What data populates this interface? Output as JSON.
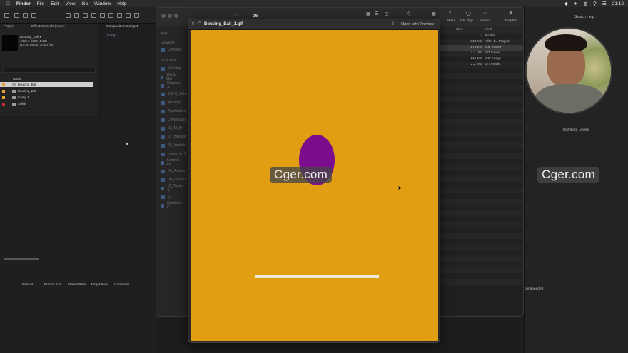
{
  "menubar": {
    "app": "Finder",
    "items": [
      "File",
      "Edit",
      "View",
      "Go",
      "Window",
      "Help"
    ],
    "time": "21:12"
  },
  "project": {
    "tab_project": "Project",
    "tab_effects": "Effect Controls (none)",
    "comp_tab": "Composition Comp 1",
    "comp_sub": "Comp 1",
    "thumb_name": "Boucing_Ball ▾",
    "thumb_info1": "1080 x 1350 (1.00)",
    "thumb_info2": "Δ 0;00;05;00, 30.00 fps",
    "col_name": "Name",
    "rows": [
      {
        "name": "Boucing_Ball",
        "color": "#e6a32b",
        "selected": true
      },
      {
        "name": "Boucing_Ball",
        "color": "#e6a32b",
        "selected": false
      },
      {
        "name": "Comp 1",
        "color": "#e6a32b",
        "selected": false
      },
      {
        "name": "Solids",
        "color": "#c8283a",
        "selected": false
      }
    ]
  },
  "timeline": {
    "columns": [
      "Format",
      "Frame Size",
      "Frame Rate",
      "Target Rate",
      "Comment"
    ]
  },
  "finder": {
    "folder": "06",
    "sidebar_sections": {
      "tags": "Tags",
      "locations": "Locations",
      "favourites": "Favourites"
    },
    "untitled": "Untitled",
    "favourites": [
      "Desktop",
      "1SFS Meh",
      "Dropbox A",
      "1SFS_Video",
      "AirDrop",
      "Application",
      "Downloads",
      "03_M_Bri",
      "01_Bk8site",
      "02_Youtub",
      "Learn_in_1",
      "Scriptol Fo",
      "06_Assets",
      "00_Design",
      "11_Tasks-S",
      "01",
      "Creative C"
    ],
    "toolbar": {
      "share": "Share",
      "add_tags": "Add Tags",
      "action": "Action",
      "dropbox": "Dropbox"
    },
    "headers": {
      "size": "Size",
      "kind": "Kind"
    },
    "rows": [
      {
        "size": "--",
        "kind": "Folder",
        "selected": false
      },
      {
        "size": "344 KB",
        "kind": "After E...Project",
        "selected": false
      },
      {
        "size": "175 KB",
        "kind": "GIF image",
        "selected": true
      },
      {
        "size": "2.1 MB",
        "kind": "QT movie",
        "selected": false
      },
      {
        "size": "211 KB",
        "kind": "GIF image",
        "selected": false
      },
      {
        "size": "2.2 MB",
        "kind": "QT movie",
        "selected": false
      }
    ]
  },
  "quicklook": {
    "title": "Boucing_Ball_1.gif",
    "open_with": "Open with Preview",
    "bg_color": "#e19e13",
    "ball_color": "#7a0e8c"
  },
  "right_panel": {
    "search": "Search Help",
    "distribute": "Distribute Layers",
    "recommended": "commended"
  },
  "watermarks": [
    "Cger.com",
    "Cger.com"
  ]
}
